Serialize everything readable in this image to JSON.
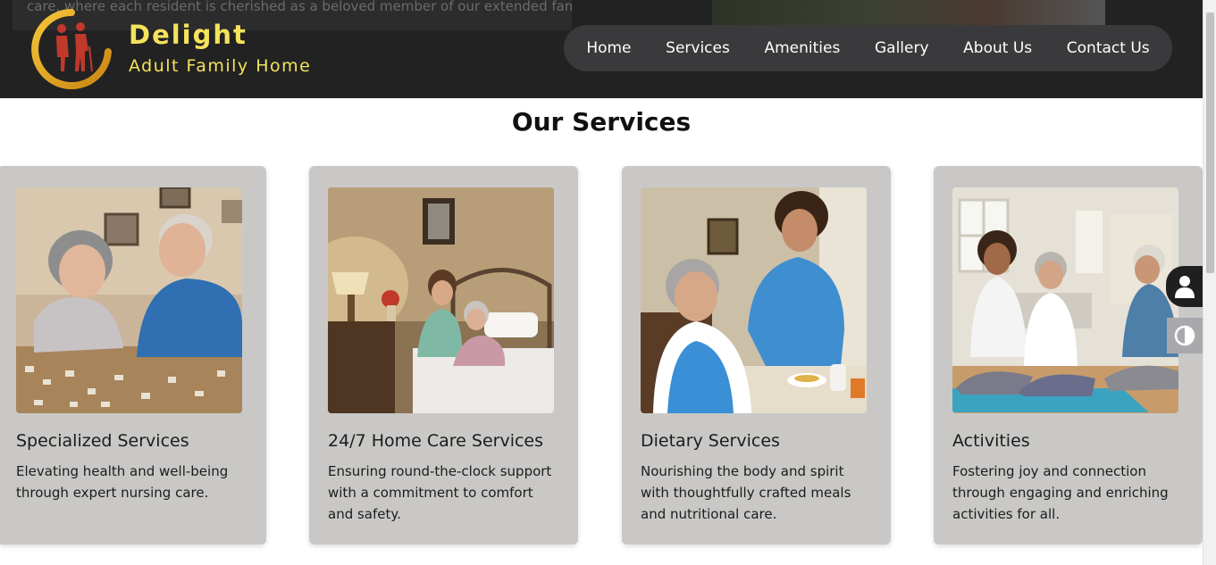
{
  "header": {
    "background_text": "care, where each resident is cherished as a beloved member of our extended family.",
    "brand_name": "Delight",
    "brand_sub": "Adult Family Home",
    "brand_color": "#f4e35c"
  },
  "nav": {
    "items": [
      {
        "label": "Home"
      },
      {
        "label": "Services"
      },
      {
        "label": "Amenities"
      },
      {
        "label": "Gallery"
      },
      {
        "label": "About Us"
      },
      {
        "label": "Contact Us"
      }
    ]
  },
  "services": {
    "title": "Our Services",
    "cards": [
      {
        "title": "Specialized Services",
        "description": "Elevating health and well-being through expert nursing care.",
        "image": "seniors-doing-puzzle"
      },
      {
        "title": "24/7 Home Care Services",
        "description": "Ensuring round-the-clock support with a commitment to comfort and safety.",
        "image": "caregiver-at-bedside"
      },
      {
        "title": "Dietary Services",
        "description": "Nourishing the body and spirit with thoughtfully crafted meals and nutritional care.",
        "image": "caregiver-serving-meal"
      },
      {
        "title": "Activities",
        "description": "Fostering joy and connection through engaging and enriching activities for all.",
        "image": "group-yoga"
      }
    ]
  },
  "widgets": {
    "accessibility_icon": "user-icon",
    "contrast_icon": "contrast-icon"
  }
}
